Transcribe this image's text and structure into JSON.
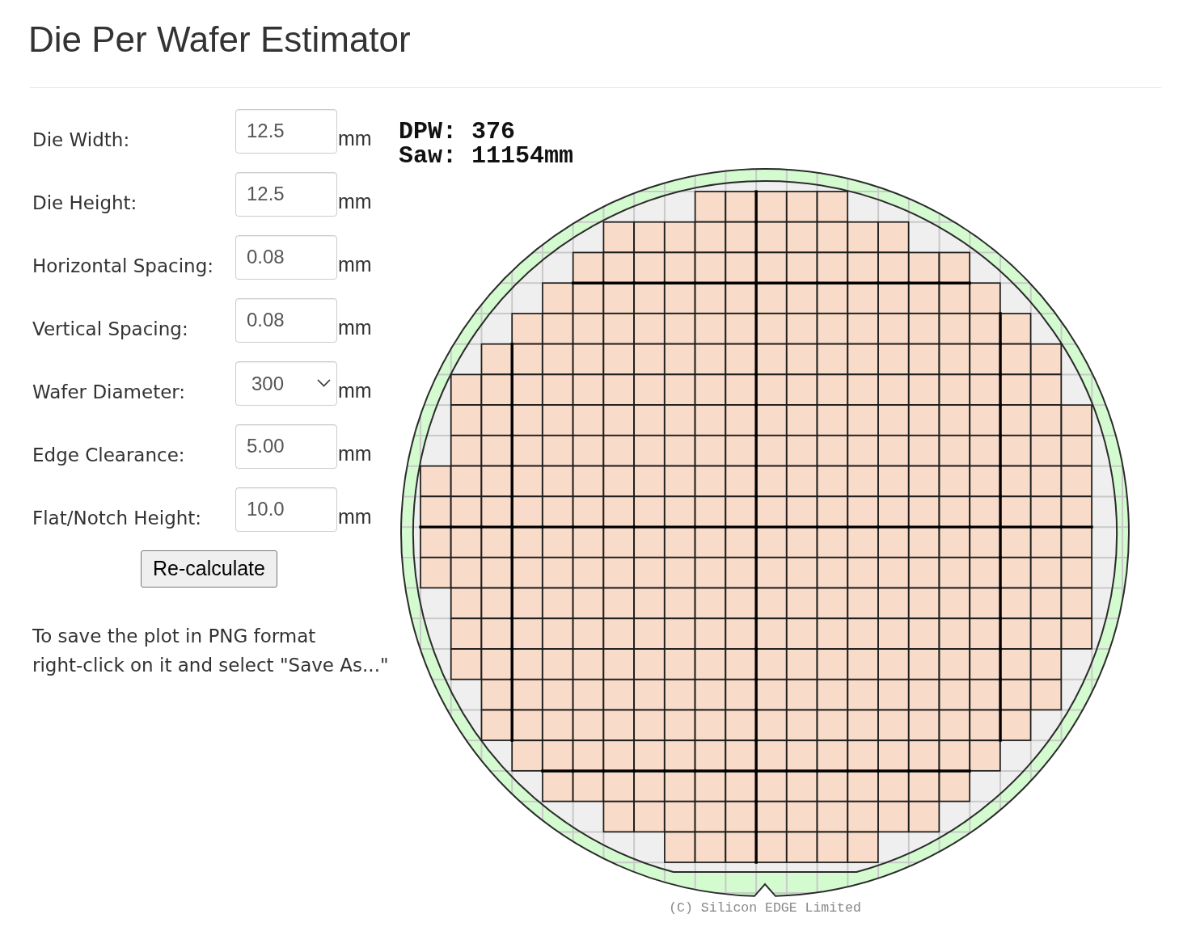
{
  "title": "Die Per Wafer Estimator",
  "form": {
    "fields": [
      {
        "label": "Die Width:",
        "kind": "input",
        "value": "12.5",
        "unit": "mm"
      },
      {
        "label": "Die Height:",
        "kind": "input",
        "value": "12.5",
        "unit": "mm"
      },
      {
        "label": "Horizontal Spacing:",
        "kind": "input",
        "value": "0.08",
        "unit": "mm"
      },
      {
        "label": "Vertical Spacing:",
        "kind": "input",
        "value": "0.08",
        "unit": "mm"
      },
      {
        "label": "Wafer Diameter:",
        "kind": "select",
        "value": "300",
        "unit": "mm"
      },
      {
        "label": "Edge Clearance:",
        "kind": "input",
        "value": "5.00",
        "unit": "mm"
      },
      {
        "label": "Flat/Notch Height:",
        "kind": "input",
        "value": "10.0",
        "unit": "mm"
      }
    ],
    "button": "Re-calculate",
    "note": "To save the plot in PNG format\nright-click on it and select \"Save As...\""
  },
  "plot": {
    "stats": [
      "DPW: 376",
      "Saw: 11154mm"
    ],
    "copyright": "(C) Silicon EDGE Limited"
  }
}
